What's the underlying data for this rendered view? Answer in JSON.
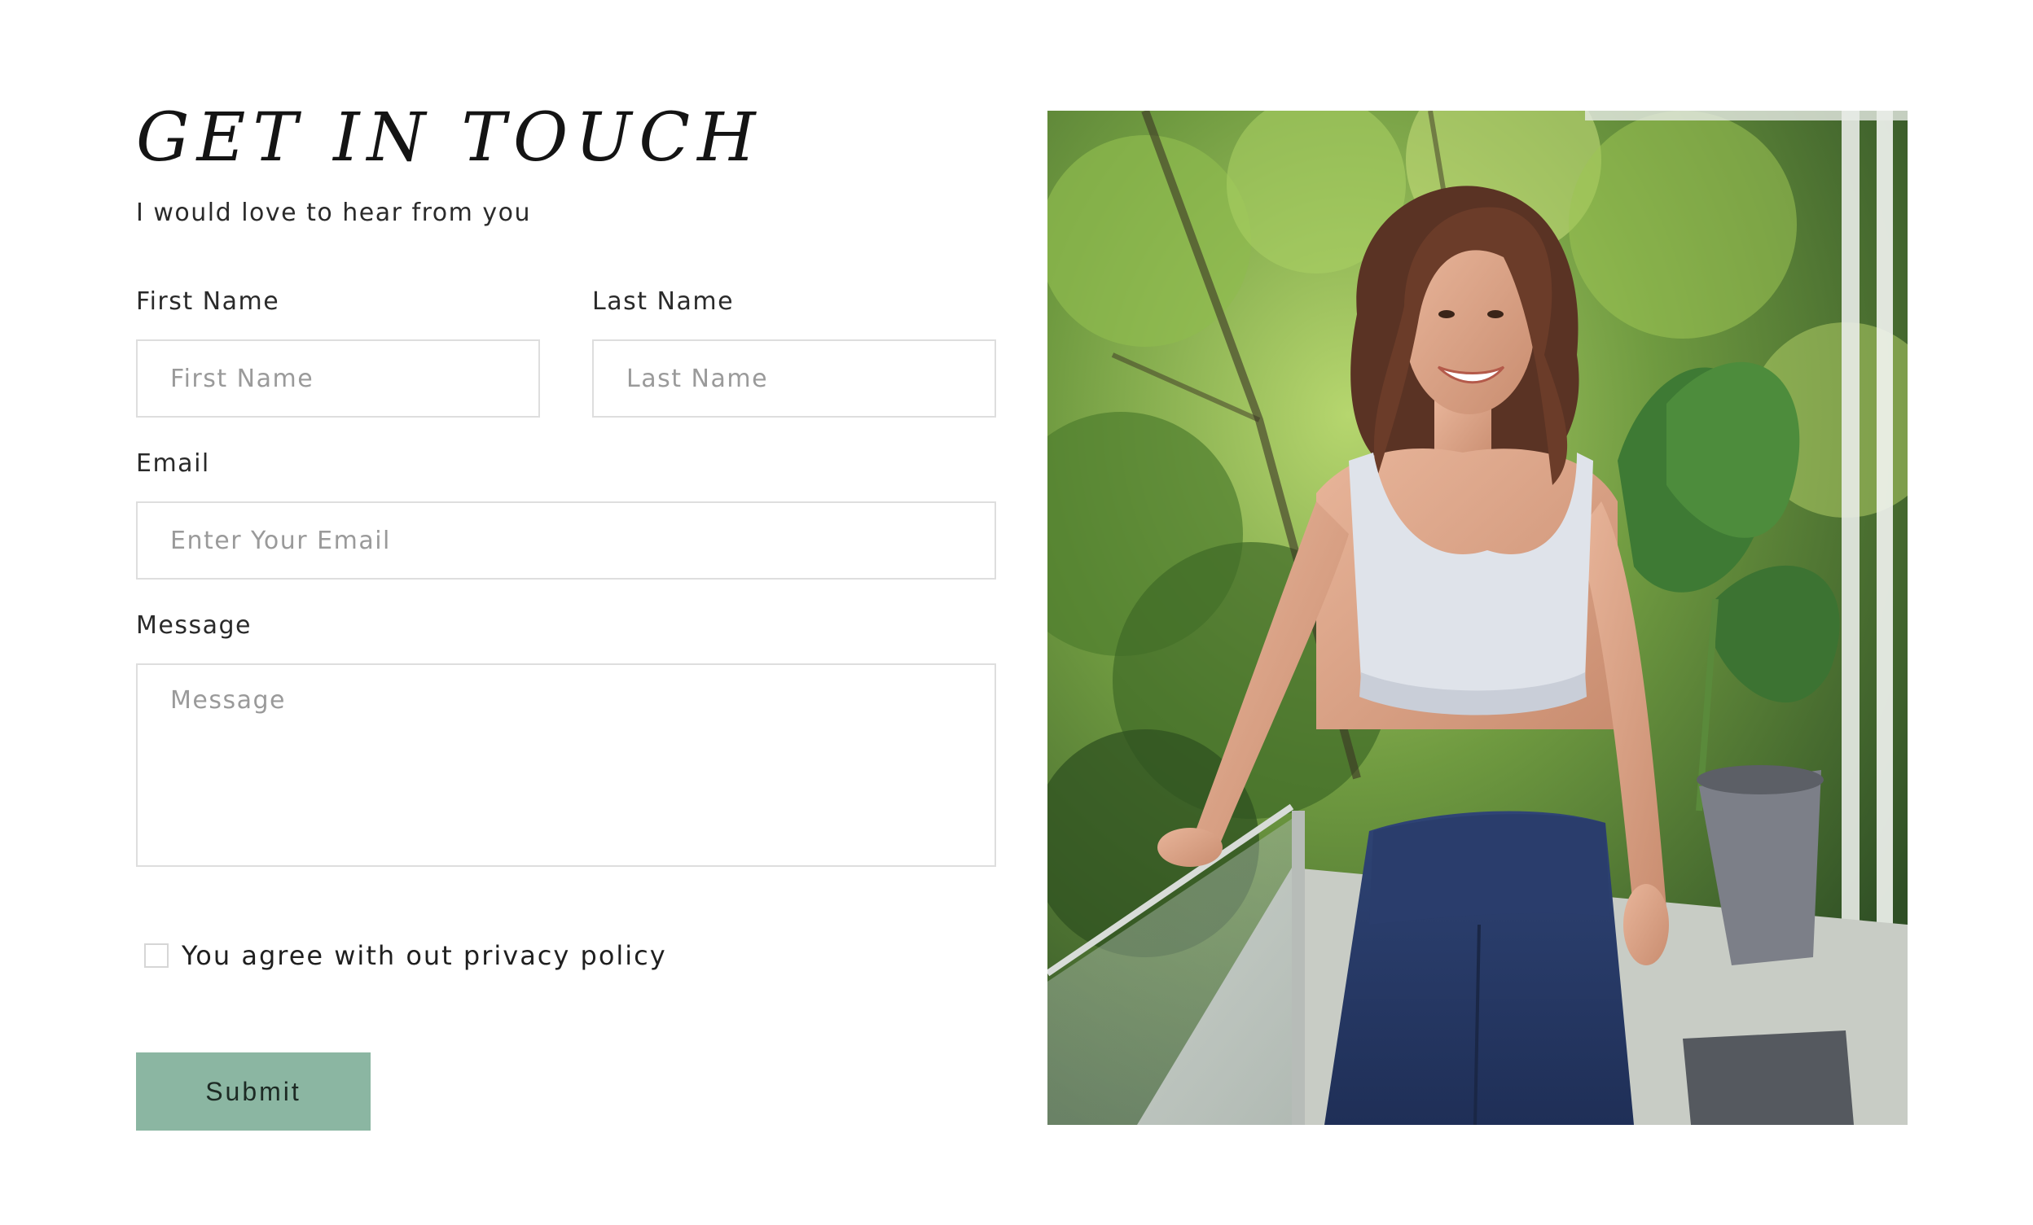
{
  "header": {
    "title": "GET IN TOUCH",
    "subtitle": "I would love to hear from you"
  },
  "form": {
    "first_name": {
      "label": "First Name",
      "placeholder": "First Name"
    },
    "last_name": {
      "label": "Last Name",
      "placeholder": "Last Name"
    },
    "email": {
      "label": "Email",
      "placeholder": "Enter Your Email"
    },
    "message": {
      "label": "Message",
      "placeholder": "Message"
    },
    "consent": {
      "label": "You agree with out privacy policy",
      "checked": false
    },
    "submit_label": "Submit"
  },
  "colors": {
    "accent": "#8bb6a2",
    "border": "#dedede",
    "placeholder": "#9a9a9a"
  }
}
